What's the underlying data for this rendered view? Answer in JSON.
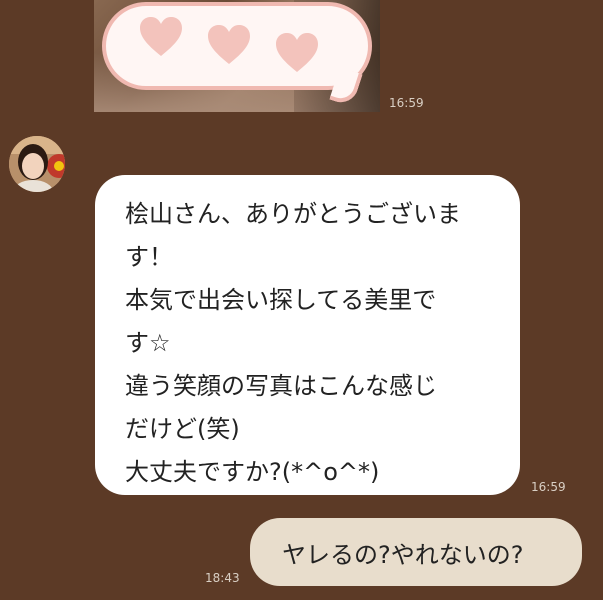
{
  "colors": {
    "background": "#5c3a26",
    "incoming_bubble": "#ffffff",
    "outgoing_bubble": "#e8ddcc",
    "timestamp": "#d9cfc4",
    "heart": "#f3c3bc"
  },
  "messages": [
    {
      "type": "image",
      "direction": "incoming",
      "time": "16:59",
      "icons": [
        "heart-icon",
        "heart-icon",
        "heart-icon"
      ]
    },
    {
      "type": "text",
      "direction": "incoming",
      "time": "16:59",
      "lines": [
        "桧山さん、ありがとうございま",
        "す！",
        "本気で出会い探してる美里で",
        "す☆",
        "違う笑顔の写真はこんな感じ",
        "だけど(笑)",
        "大丈夫ですか?(*^o^*)"
      ]
    },
    {
      "type": "text",
      "direction": "outgoing",
      "time": "18:43",
      "lines": [
        "ヤレるの?やれないの?"
      ]
    }
  ]
}
